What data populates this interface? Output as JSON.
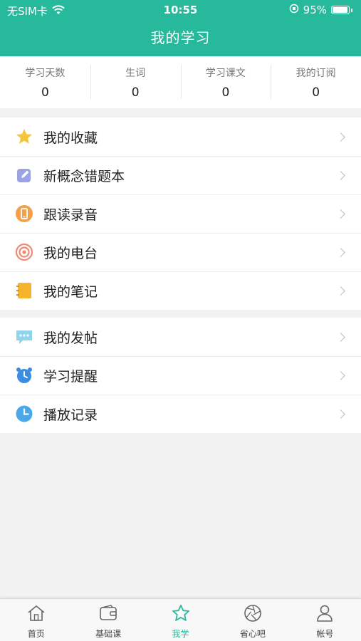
{
  "status_bar": {
    "carrier": "无SIM卡",
    "time": "10:55",
    "battery": "95%"
  },
  "header": {
    "title": "我的学习"
  },
  "stats": [
    {
      "label": "学习天数",
      "value": "0"
    },
    {
      "label": "生词",
      "value": "0"
    },
    {
      "label": "学习课文",
      "value": "0"
    },
    {
      "label": "我的订阅",
      "value": "0"
    }
  ],
  "menu_group1": [
    {
      "label": "我的收藏",
      "icon": "star-icon"
    },
    {
      "label": "新概念错题本",
      "icon": "edit-icon"
    },
    {
      "label": "跟读录音",
      "icon": "phone-record-icon"
    },
    {
      "label": "我的电台",
      "icon": "radio-icon"
    },
    {
      "label": "我的笔记",
      "icon": "notebook-icon"
    }
  ],
  "menu_group2": [
    {
      "label": "我的发帖",
      "icon": "chat-bubble-icon"
    },
    {
      "label": "学习提醒",
      "icon": "alarm-clock-icon"
    },
    {
      "label": "播放记录",
      "icon": "clock-icon"
    }
  ],
  "tabbar": [
    {
      "label": "首页",
      "icon": "home-icon"
    },
    {
      "label": "基础课",
      "icon": "wallet-icon"
    },
    {
      "label": "我学",
      "icon": "star-outline-icon",
      "active": true
    },
    {
      "label": "省心吧",
      "icon": "aperture-icon"
    },
    {
      "label": "帐号",
      "icon": "user-icon"
    }
  ],
  "colors": {
    "brand": "#26b99b",
    "background": "#f2f2f2"
  }
}
